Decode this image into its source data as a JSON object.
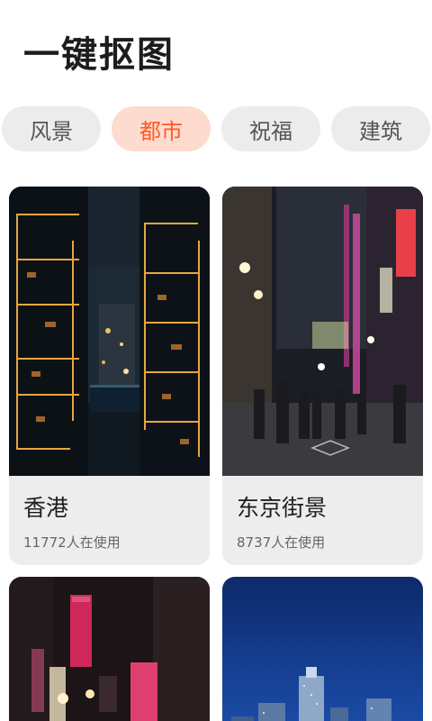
{
  "header": {
    "title": "一键抠图"
  },
  "tabs": [
    {
      "label": "风景",
      "active": false
    },
    {
      "label": "都市",
      "active": true
    },
    {
      "label": "祝福",
      "active": false
    },
    {
      "label": "建筑",
      "active": false
    }
  ],
  "cards": [
    {
      "name": "香港",
      "usage": "11772人在使用"
    },
    {
      "name": "东京街景",
      "usage": "8737人在使用"
    },
    {
      "name": "",
      "usage": ""
    },
    {
      "name": "",
      "usage": ""
    }
  ],
  "colors": {
    "accent": "#ff5a1f",
    "accent_bg": "#fddbcf",
    "tab_bg": "#ececec",
    "card_bg": "#ededed"
  }
}
